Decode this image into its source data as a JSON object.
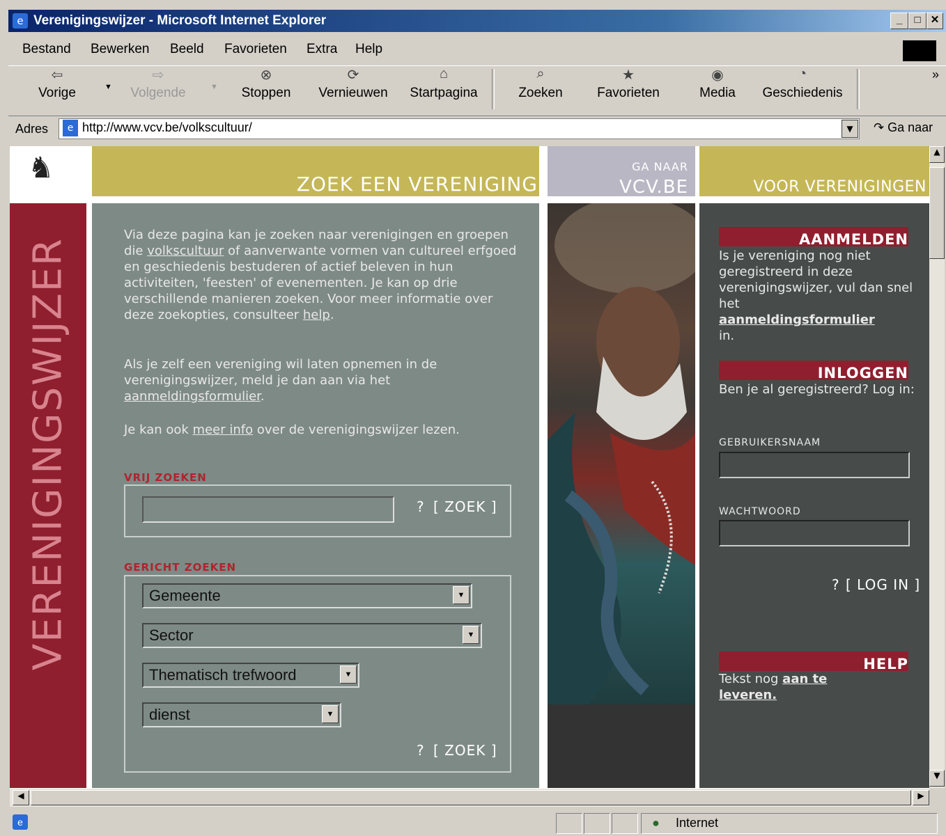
{
  "window": {
    "title": "Verenigingswijzer - Microsoft Internet Explorer"
  },
  "menu": [
    "Bestand",
    "Bewerken",
    "Beeld",
    "Favorieten",
    "Extra",
    "Help"
  ],
  "toolbar": {
    "back": "Vorige",
    "forward": "Volgende",
    "stop": "Stoppen",
    "refresh": "Vernieuwen",
    "home": "Startpagina",
    "search": "Zoeken",
    "favorites": "Favorieten",
    "media": "Media",
    "history": "Geschiedenis",
    "more": "»"
  },
  "address": {
    "label": "Adres",
    "url": "http://www.vcv.be/volkscultuur/",
    "go": "Ga naar"
  },
  "header": {
    "zoek": "ZOEK EEN VERENIGING",
    "ganaar": "GA NAAR",
    "vcv": "VCV.BE",
    "voor": "VOOR VERENIGINGEN"
  },
  "sidebar": {
    "title": "VERENIGINGSWIJZER"
  },
  "intro": {
    "p1_a": "Via deze pagina kan je zoeken naar verenigingen en groepen die ",
    "p1_link": "volkscultuur",
    "p1_b": " of aanverwante vormen van cultureel erfgoed en geschiedenis bestuderen of actief beleven in hun activiteiten, 'feesten' of evenementen. Je kan op drie verschillende manieren zoeken. Voor meer informatie over deze zoekopties, consulteer ",
    "p1_help": "help",
    "p1_end": ".",
    "p2_a": "Als je zelf een vereniging wil laten opnemen in de verenigingswijzer, meld je dan aan via het ",
    "p2_link": "aanmeldingsformulier",
    "p2_end": ".",
    "p3_a": "Je kan ook ",
    "p3_link": "meer info",
    "p3_b": " over de verenigingswijzer lezen."
  },
  "vrij": {
    "title": "VRIJ ZOEKEN",
    "q": "?",
    "zoek": "[ ZOEK ]"
  },
  "gericht": {
    "title": "GERICHT ZOEKEN",
    "gemeente": "Gemeente",
    "sector": "Sector",
    "trefwoord": "Thematisch trefwoord",
    "dienst": "dienst",
    "q": "?",
    "zoek": "[ ZOEK ]"
  },
  "aanmelden": {
    "title": "AANMELDEN",
    "text": "Is je vereniging nog niet geregistreerd in deze verenigingswijzer, vul dan snel het",
    "link": "aanmeldingsformulier",
    "end": "in."
  },
  "inloggen": {
    "title": "INLOGGEN",
    "text": "Ben je al geregistreerd? Log in:",
    "user_label": "GEBRUIKERSNAAM",
    "pass_label": "WACHTWOORD",
    "q": "?",
    "login": "[ LOG IN ]"
  },
  "help": {
    "title": "HELP",
    "text": "Tekst nog ",
    "link": "aan te leveren."
  },
  "status": {
    "zone": "Internet"
  }
}
